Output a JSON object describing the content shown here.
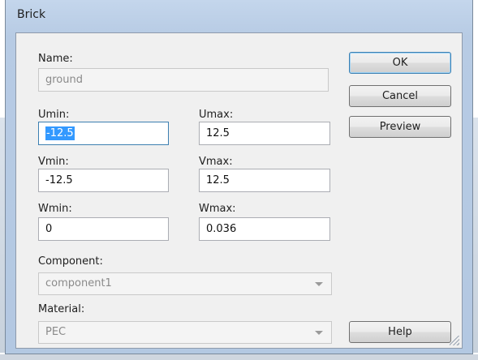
{
  "window": {
    "title": "Brick"
  },
  "form": {
    "name_label": "Name:",
    "name_value": "ground",
    "umin_label": "Umin:",
    "umin_value": "-12.5",
    "umax_label": "Umax:",
    "umax_value": "12.5",
    "vmin_label": "Vmin:",
    "vmin_value": "-12.5",
    "vmax_label": "Vmax:",
    "vmax_value": "12.5",
    "wmin_label": "Wmin:",
    "wmin_value": "0",
    "wmax_label": "Wmax:",
    "wmax_value": "0.036",
    "component_label": "Component:",
    "component_value": "component1",
    "material_label": "Material:",
    "material_value": "PEC"
  },
  "buttons": {
    "ok": "OK",
    "cancel": "Cancel",
    "preview": "Preview",
    "help": "Help"
  },
  "icons": {
    "dropdown": "chevron-down-icon",
    "resize": "resize-grip-icon"
  },
  "colors": {
    "title_bar": "#c4d6ec",
    "client_bg": "#f0f0f0",
    "selection": "#3399ff",
    "focus_border": "#3c7fb1"
  }
}
